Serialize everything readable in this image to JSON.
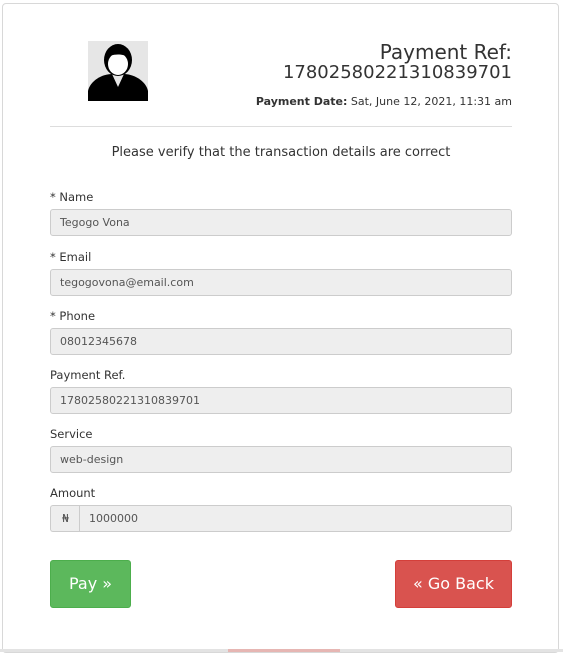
{
  "header": {
    "ref_title": "Payment Ref:",
    "ref_number": "17802580221310839701",
    "date_label": "Payment Date:",
    "date_value": " Sat, June 12, 2021, 11:31 am",
    "avatar_icon": "user-avatar-icon"
  },
  "verify_text": "Please verify that the transaction details are correct",
  "form": {
    "name": {
      "label": "* Name",
      "value": "Tegogo Vona"
    },
    "email": {
      "label": "* Email",
      "value": "tegogovona@email.com"
    },
    "phone": {
      "label": "* Phone",
      "value": "08012345678"
    },
    "payment_ref": {
      "label": "Payment Ref.",
      "value": "17802580221310839701"
    },
    "service": {
      "label": "Service",
      "value": "web-design"
    },
    "amount": {
      "label": "Amount",
      "currency": "₦",
      "value": "1000000"
    }
  },
  "buttons": {
    "pay": "Pay »",
    "back": "« Go Back"
  },
  "colors": {
    "pay": "#5cb85c",
    "back": "#d9534f"
  }
}
